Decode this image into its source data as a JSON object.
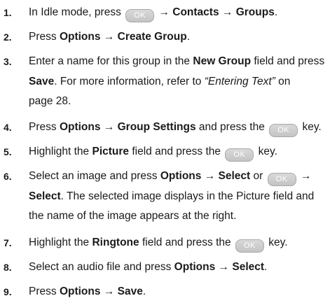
{
  "key_label": "OK",
  "arrow": "→",
  "steps": [
    {
      "num": "1.",
      "p1": "In Idle mode, press",
      "p2": "Contacts",
      "p3": "Groups",
      "p4": "."
    },
    {
      "num": "2.",
      "p1": "Press",
      "p2": "Options",
      "p3": "Create Group",
      "p4": "."
    },
    {
      "num": "3.",
      "p1": "Enter a name for this group in the",
      "p2": "New Group",
      "p3": "field and press",
      "p4": "Save",
      "p5": ". For more information, refer to",
      "p6": "“Entering Text”",
      "p7": "on",
      "p8": "page 28."
    },
    {
      "num": "4.",
      "p1": "Press",
      "p2": "Options",
      "p3": "Group Settings",
      "p4": "and press the",
      "p5": "key."
    },
    {
      "num": "5.",
      "p1": "Highlight the",
      "p2": "Picture",
      "p3": "field and press the",
      "p4": "key."
    },
    {
      "num": "6.",
      "p1": "Select an image and press",
      "p2": "Options",
      "p3": "Select",
      "p4": "or",
      "p5": "Select",
      "p6": ". The selected image displays in the Picture field and",
      "p7": "the name of the image appears at the right."
    },
    {
      "num": "7.",
      "p1": "Highlight the",
      "p2": "Ringtone",
      "p3": "field and press the",
      "p4": "key."
    },
    {
      "num": "8.",
      "p1": "Select an audio file and press",
      "p2": "Options",
      "p3": "Select",
      "p4": "."
    },
    {
      "num": "9.",
      "p1": "Press",
      "p2": "Options",
      "p3": "Save",
      "p4": "."
    }
  ]
}
